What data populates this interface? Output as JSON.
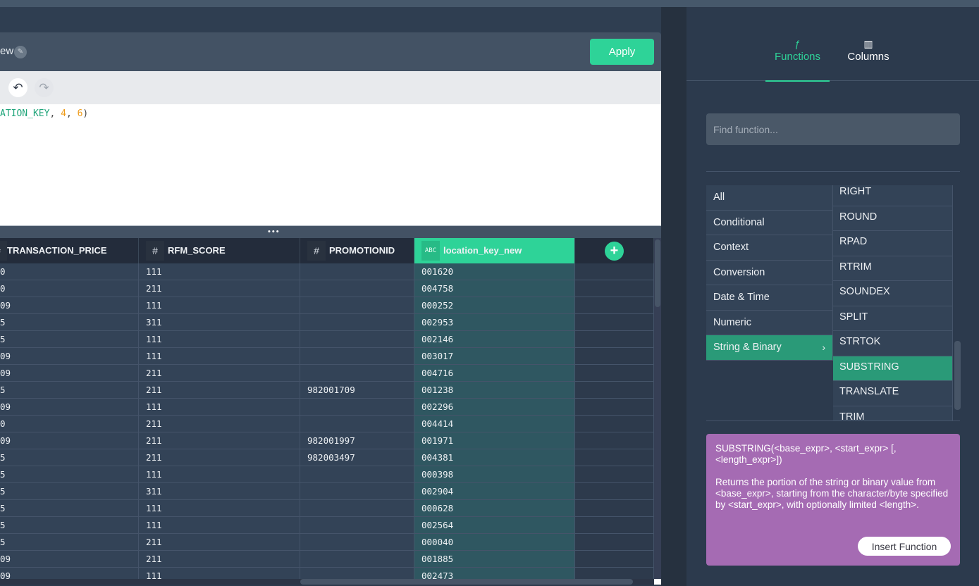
{
  "editor": {
    "title_fragment": "ew",
    "apply_label": "Apply",
    "undo_icon": "undo-icon",
    "redo_icon": "redo-icon",
    "code": {
      "column_fragment": "ATION_KEY",
      "sep1": ", ",
      "arg1": "4",
      "sep2": ", ",
      "arg2": "6",
      "close": ")"
    },
    "splitter_glyph": "•••"
  },
  "grid": {
    "columns": [
      {
        "type": "#",
        "label": "TRANSACTION_PRICE"
      },
      {
        "type": "#",
        "label": "RFM_SCORE"
      },
      {
        "type": "#",
        "label": "PROMOTIONID"
      },
      {
        "type": "ABC",
        "label": "location_key_new"
      }
    ],
    "add_column_icon": "+",
    "rows": [
      [
        "0",
        "111",
        "",
        "001620"
      ],
      [
        "0",
        "211",
        "",
        "004758"
      ],
      [
        "09",
        "111",
        "",
        "000252"
      ],
      [
        "5",
        "311",
        "",
        "002953"
      ],
      [
        "5",
        "111",
        "",
        "002146"
      ],
      [
        "09",
        "111",
        "",
        "003017"
      ],
      [
        "09",
        "211",
        "",
        "004716"
      ],
      [
        "5",
        "211",
        "982001709",
        "001238"
      ],
      [
        "09",
        "111",
        "",
        "002296"
      ],
      [
        "0",
        "211",
        "",
        "004414"
      ],
      [
        "09",
        "211",
        "982001997",
        "001971"
      ],
      [
        "5",
        "211",
        "982003497",
        "004381"
      ],
      [
        "5",
        "111",
        "",
        "000398"
      ],
      [
        "5",
        "311",
        "",
        "002904"
      ],
      [
        "5",
        "111",
        "",
        "000628"
      ],
      [
        "5",
        "111",
        "",
        "002564"
      ],
      [
        "5",
        "211",
        "",
        "000040"
      ],
      [
        "09",
        "211",
        "",
        "001885"
      ],
      [
        "09",
        "111",
        "",
        "002473"
      ]
    ]
  },
  "panel": {
    "tabs": [
      {
        "icon": "ƒ",
        "label": "Functions",
        "active": true
      },
      {
        "icon": "▥",
        "label": "Columns",
        "active": false
      }
    ],
    "search_placeholder": "Find function...",
    "categories": [
      "All",
      "Conditional",
      "Context",
      "Conversion",
      "Date & Time",
      "Numeric",
      "String & Binary"
    ],
    "selected_category": "String & Binary",
    "functions": [
      "RIGHT",
      "ROUND",
      "RPAD",
      "RTRIM",
      "SOUNDEX",
      "SPLIT",
      "STRTOK",
      "SUBSTRING",
      "TRANSLATE",
      "TRIM"
    ],
    "selected_function": "SUBSTRING",
    "info": {
      "signature": "SUBSTRING(<base_expr>, <start_expr> [, <length_expr>])",
      "description": "Returns the portion of the string or binary value from <base_expr>, starting from the character/byte specified by <start_expr>, with optionally limited <length>.",
      "insert_label": "Insert Function"
    }
  },
  "colors": {
    "accent": "#2ed398",
    "selected": "#2a9a78",
    "info_bg": "#a56bb3"
  }
}
